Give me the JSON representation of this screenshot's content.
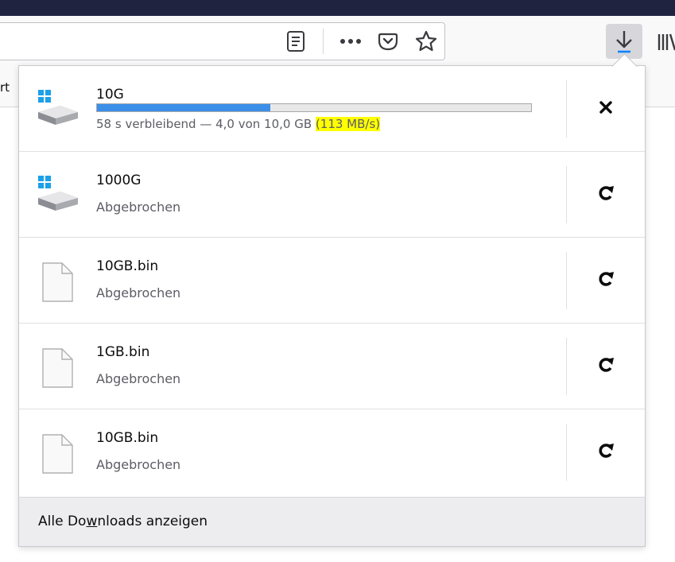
{
  "browser": {
    "bookmarks_partial_text": "rt",
    "icons": [
      "reader-view-icon",
      "page-actions-icon",
      "pocket-icon",
      "bookmark-star-icon",
      "downloads-icon",
      "library-icon"
    ]
  },
  "downloads": [
    {
      "name": "10G",
      "status_prefix": "58 s verbleibend — 4,0 von 10,0 GB ",
      "speed": "(113 MB/s)",
      "progress": 0.4,
      "type": "disk-image",
      "action": "cancel"
    },
    {
      "name": "1000G",
      "status": "Abgebrochen",
      "type": "disk-image",
      "action": "retry"
    },
    {
      "name": "10GB.bin",
      "status": "Abgebrochen",
      "type": "file",
      "action": "retry"
    },
    {
      "name": "1GB.bin",
      "status": "Abgebrochen",
      "type": "file",
      "action": "retry"
    },
    {
      "name": "10GB.bin",
      "status": "Abgebrochen",
      "type": "file",
      "action": "retry"
    }
  ],
  "footer": {
    "before": "Alle Do",
    "accesskey": "w",
    "after": "nloads anzeigen"
  },
  "colors": {
    "progress_fill": "#3b8fe8",
    "speed_highlight": "#ffff00",
    "top_bar": "#202340"
  }
}
